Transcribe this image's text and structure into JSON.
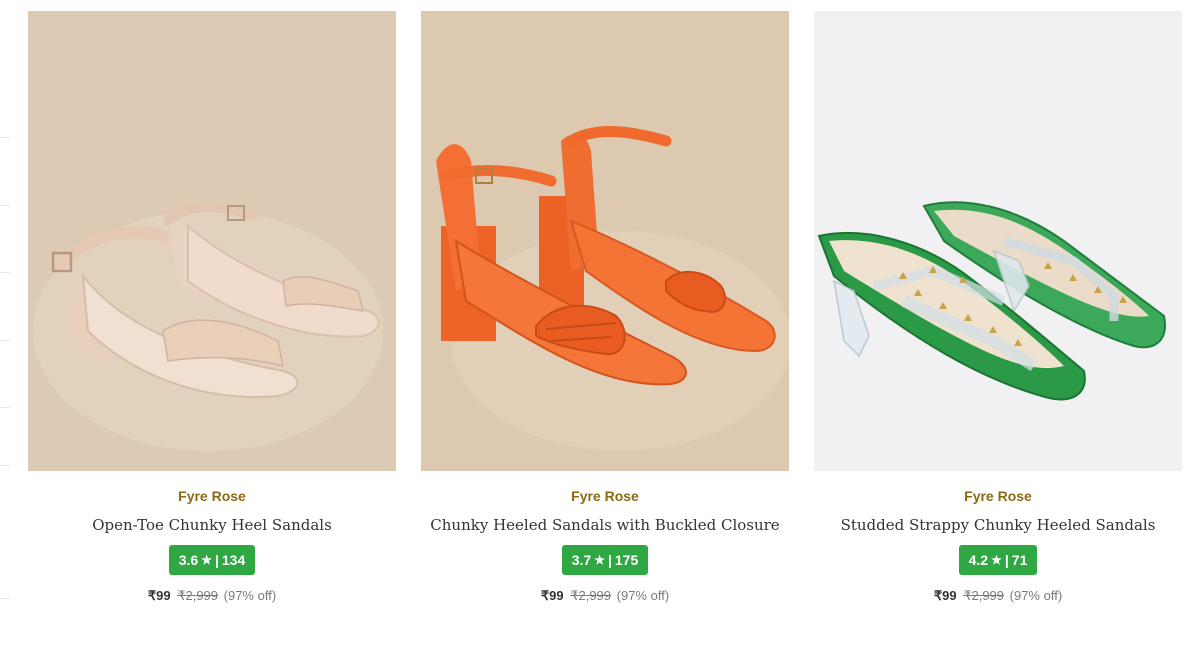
{
  "products": [
    {
      "brand": "Fyre Rose",
      "name": "Open-Toe Chunky Heel Sandals",
      "rating": "3.6",
      "reviews": "134",
      "price": "₹99",
      "mrp": "₹2,999",
      "discount": "(97% off)",
      "color": "#e9cfb8",
      "background": "#dccab4"
    },
    {
      "brand": "Fyre Rose",
      "name": "Chunky Heeled Sandals with Buckled Closure",
      "rating": "3.7",
      "reviews": "175",
      "price": "₹99",
      "mrp": "₹2,999",
      "discount": "(97% off)",
      "color": "#f26a2e",
      "background": "#dcc9b0"
    },
    {
      "brand": "Fyre Rose",
      "name": "Studded Strappy Chunky Heeled Sandals",
      "rating": "4.2",
      "reviews": "71",
      "price": "₹99",
      "mrp": "₹2,999",
      "discount": "(97% off)",
      "color": "#2a9a46",
      "background": "#f1f1f3"
    }
  ],
  "ui": {
    "star_icon": "★",
    "separator": "|",
    "rating_color": "#2fa844",
    "brand_color": "#8a6a12"
  }
}
